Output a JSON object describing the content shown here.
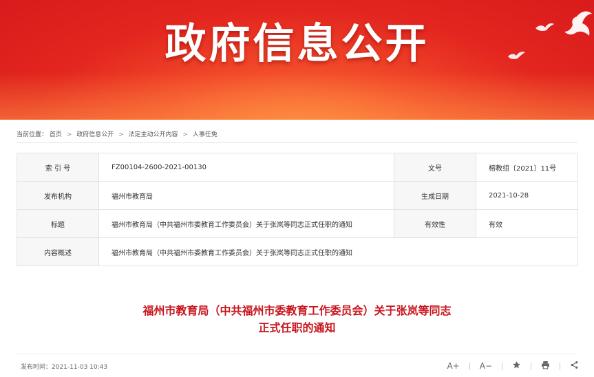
{
  "banner": {
    "title": "政府信息公开"
  },
  "breadcrumb": {
    "prefix": "当前位置：",
    "items": [
      "首页",
      "政府信息公开",
      "法定主动公开内容",
      "人事任免"
    ],
    "separator": ">"
  },
  "info_table": {
    "index_label": "索 引 号",
    "index_value": "FZ00104-2600-2021-00130",
    "docno_label": "文号",
    "docno_value": "榕教组〔2021〕11号",
    "publisher_label": "发布机构",
    "publisher_value": "福州市教育局",
    "date_label": "生成日期",
    "date_value": "2021-10-28",
    "title_label": "标题",
    "title_value": "福州市教育局（中共福州市委教育工作委员会）关于张岚等同志正式任职的通知",
    "validity_label": "有效性",
    "validity_value": "有效",
    "summary_label": "内容概述",
    "summary_value": "福州市教育局（中共福州市委教育工作委员会）关于张岚等同志正式任职的通知"
  },
  "document": {
    "title_line1": "福州市教育局（中共福州市委教育工作委员会）关于张岚等同志",
    "title_line2": "正式任职的通知",
    "publish_time": "发布时间：2021-11-03 10:43"
  },
  "tools": {
    "font_increase": "A+",
    "font_decrease": "A−",
    "favorite_icon": "star-icon",
    "print_icon": "print-icon",
    "share_icon": "share-icon"
  },
  "colors": {
    "banner_red": "#e3261f",
    "title_red": "#c8151d",
    "label_bg": "#f7f7f7"
  }
}
